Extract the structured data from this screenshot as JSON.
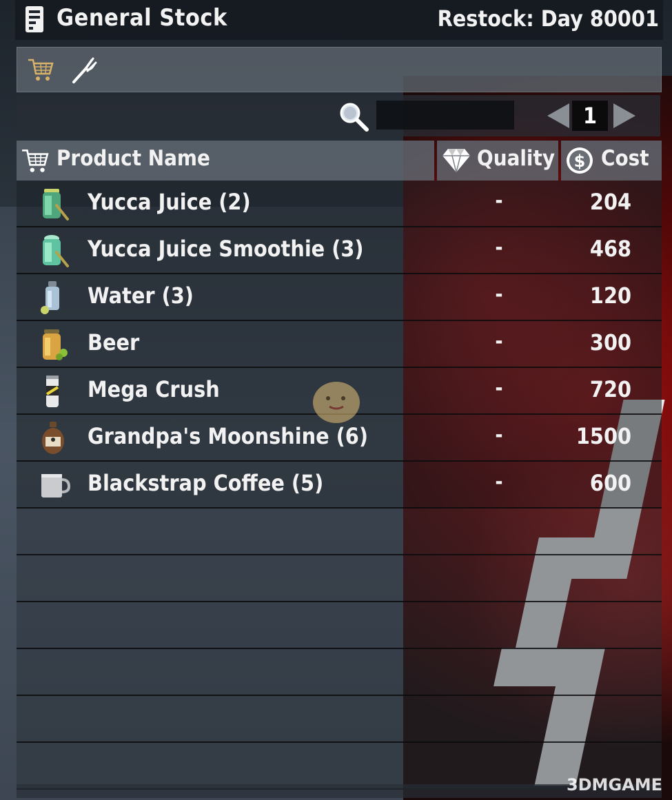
{
  "header": {
    "title": "General Stock",
    "restock": "Restock: Day 80001"
  },
  "tabs": [
    {
      "icon": "shopping-cart-icon"
    },
    {
      "icon": "fork-icon"
    }
  ],
  "search": {
    "value": "",
    "placeholder": ""
  },
  "pager": {
    "page": "1"
  },
  "columns": {
    "name": "Product Name",
    "quality": "Quality",
    "cost": "Cost"
  },
  "items": [
    {
      "name": "Yucca Juice (2)",
      "quality": "-",
      "cost": "204",
      "icon": "yucca-juice-icon"
    },
    {
      "name": "Yucca Juice Smoothie (3)",
      "quality": "-",
      "cost": "468",
      "icon": "yucca-smoothie-icon"
    },
    {
      "name": "Water (3)",
      "quality": "-",
      "cost": "120",
      "icon": "water-jar-icon"
    },
    {
      "name": "Beer",
      "quality": "-",
      "cost": "300",
      "icon": "beer-icon"
    },
    {
      "name": "Mega Crush",
      "quality": "-",
      "cost": "720",
      "icon": "mega-crush-can-icon"
    },
    {
      "name": "Grandpa's Moonshine (6)",
      "quality": "-",
      "cost": "1500",
      "icon": "moonshine-jug-icon"
    },
    {
      "name": "Blackstrap Coffee (5)",
      "quality": "-",
      "cost": "600",
      "icon": "coffee-mug-icon"
    }
  ],
  "watermark": "3DMGAME",
  "colors": {
    "accent_cart": "#d8b26a",
    "text": "#f2f2f2",
    "row_divider": "#0a0a0c"
  }
}
